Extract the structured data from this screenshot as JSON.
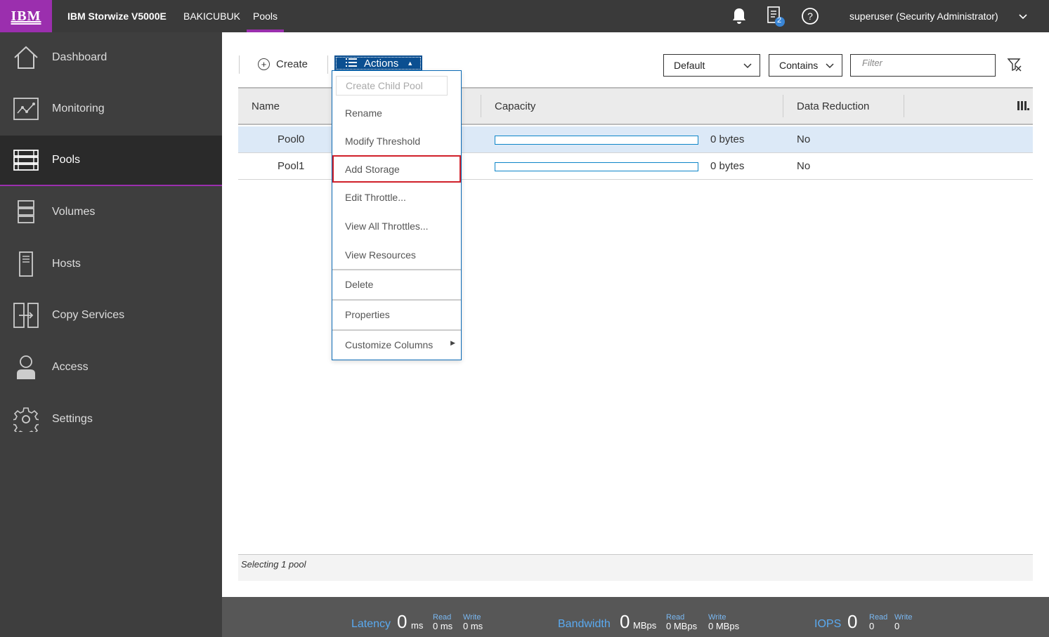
{
  "topbar": {
    "logo_text": "IBM",
    "product_name": "IBM Storwize V5000E",
    "system_name": "BAKICUBUK",
    "breadcrumb_current": "Pools",
    "tasks_badge": "2",
    "user_label": "superuser (Security Administrator)",
    "icons": [
      "bell-icon",
      "tasks-icon",
      "help-icon",
      "chevron-down-icon"
    ]
  },
  "sidebar": {
    "items": [
      {
        "label": "Dashboard",
        "icon": "home-icon"
      },
      {
        "label": "Monitoring",
        "icon": "monitoring-icon"
      },
      {
        "label": "Pools",
        "icon": "pools-icon",
        "active": true
      },
      {
        "label": "Volumes",
        "icon": "volumes-icon"
      },
      {
        "label": "Hosts",
        "icon": "hosts-icon"
      },
      {
        "label": "Copy Services",
        "icon": "copy-services-icon"
      },
      {
        "label": "Access",
        "icon": "access-icon"
      },
      {
        "label": "Settings",
        "icon": "settings-icon"
      }
    ],
    "accent_color": "#9b2fae"
  },
  "toolbar": {
    "create_label": "Create",
    "actions_label": "Actions",
    "view_select": "Default",
    "match_select": "Contains",
    "filter_placeholder": "Filter"
  },
  "actions_menu": {
    "items": [
      {
        "label": "Create Child Pool",
        "disabled": true
      },
      {
        "label": "Rename"
      },
      {
        "label": "Modify Threshold"
      },
      {
        "label": "Add Storage",
        "highlighted": true
      },
      {
        "label": "Edit Throttle..."
      },
      {
        "label": "View All Throttles..."
      },
      {
        "label": "View Resources"
      },
      {
        "label": "Delete"
      },
      {
        "label": "Properties"
      },
      {
        "label": "Customize Columns"
      }
    ]
  },
  "table": {
    "columns": [
      "Name",
      "Capacity",
      "Data Reduction"
    ],
    "rows": [
      {
        "name": "Pool0",
        "capacity": "0 bytes",
        "capacity_used_fraction": 0,
        "data_reduction": "No",
        "selected": true
      },
      {
        "name": "Pool1",
        "capacity": "0 bytes",
        "capacity_used_fraction": 0,
        "data_reduction": "No",
        "selected": false
      }
    ]
  },
  "status": {
    "text": "Selecting 1 pool"
  },
  "performance": {
    "latency": {
      "label": "Latency",
      "value": "0",
      "unit": "ms",
      "read_label": "Read",
      "read_value": "0 ms",
      "write_label": "Write",
      "write_value": "0 ms"
    },
    "bandwidth": {
      "label": "Bandwidth",
      "value": "0",
      "unit": "MBps",
      "read_label": "Read",
      "read_value": "0 MBps",
      "write_label": "Write",
      "write_value": "0 MBps"
    },
    "iops": {
      "label": "IOPS",
      "value": "0",
      "read_label": "Read",
      "read_value": "0",
      "write_label": "Write",
      "write_value": "0"
    }
  }
}
